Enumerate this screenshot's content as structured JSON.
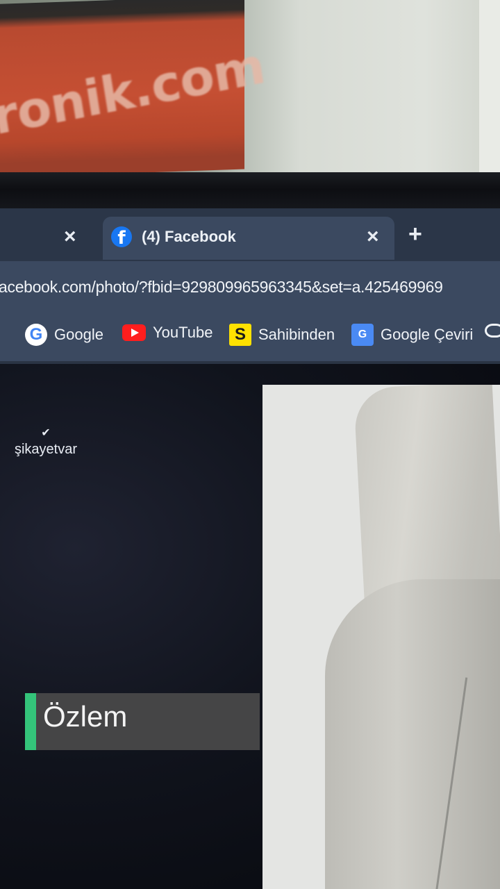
{
  "scene": {
    "sign_text": "ronik.com"
  },
  "browser": {
    "tabs": [
      {
        "title": "",
        "close_icon": "×"
      },
      {
        "title": "(4) Facebook",
        "favicon": "facebook-icon",
        "close_icon": "×",
        "active": true
      }
    ],
    "new_tab_icon": "+",
    "address_bar": {
      "url": "acebook.com/photo/?fbid=929809965963345&set=a.425469969"
    },
    "bookmarks": [
      {
        "label": "Google",
        "icon": "google-icon"
      },
      {
        "label": "YouTube",
        "icon": "youtube-icon"
      },
      {
        "label": "Sahibinden",
        "icon": "sahibinden-icon",
        "glyph": "S"
      },
      {
        "label": "Google Çeviri",
        "icon": "google-translate-icon"
      }
    ]
  },
  "overlay": {
    "brand": "şikayetvar",
    "caption_name": "Özlem",
    "accent_color": "#34c47a"
  }
}
